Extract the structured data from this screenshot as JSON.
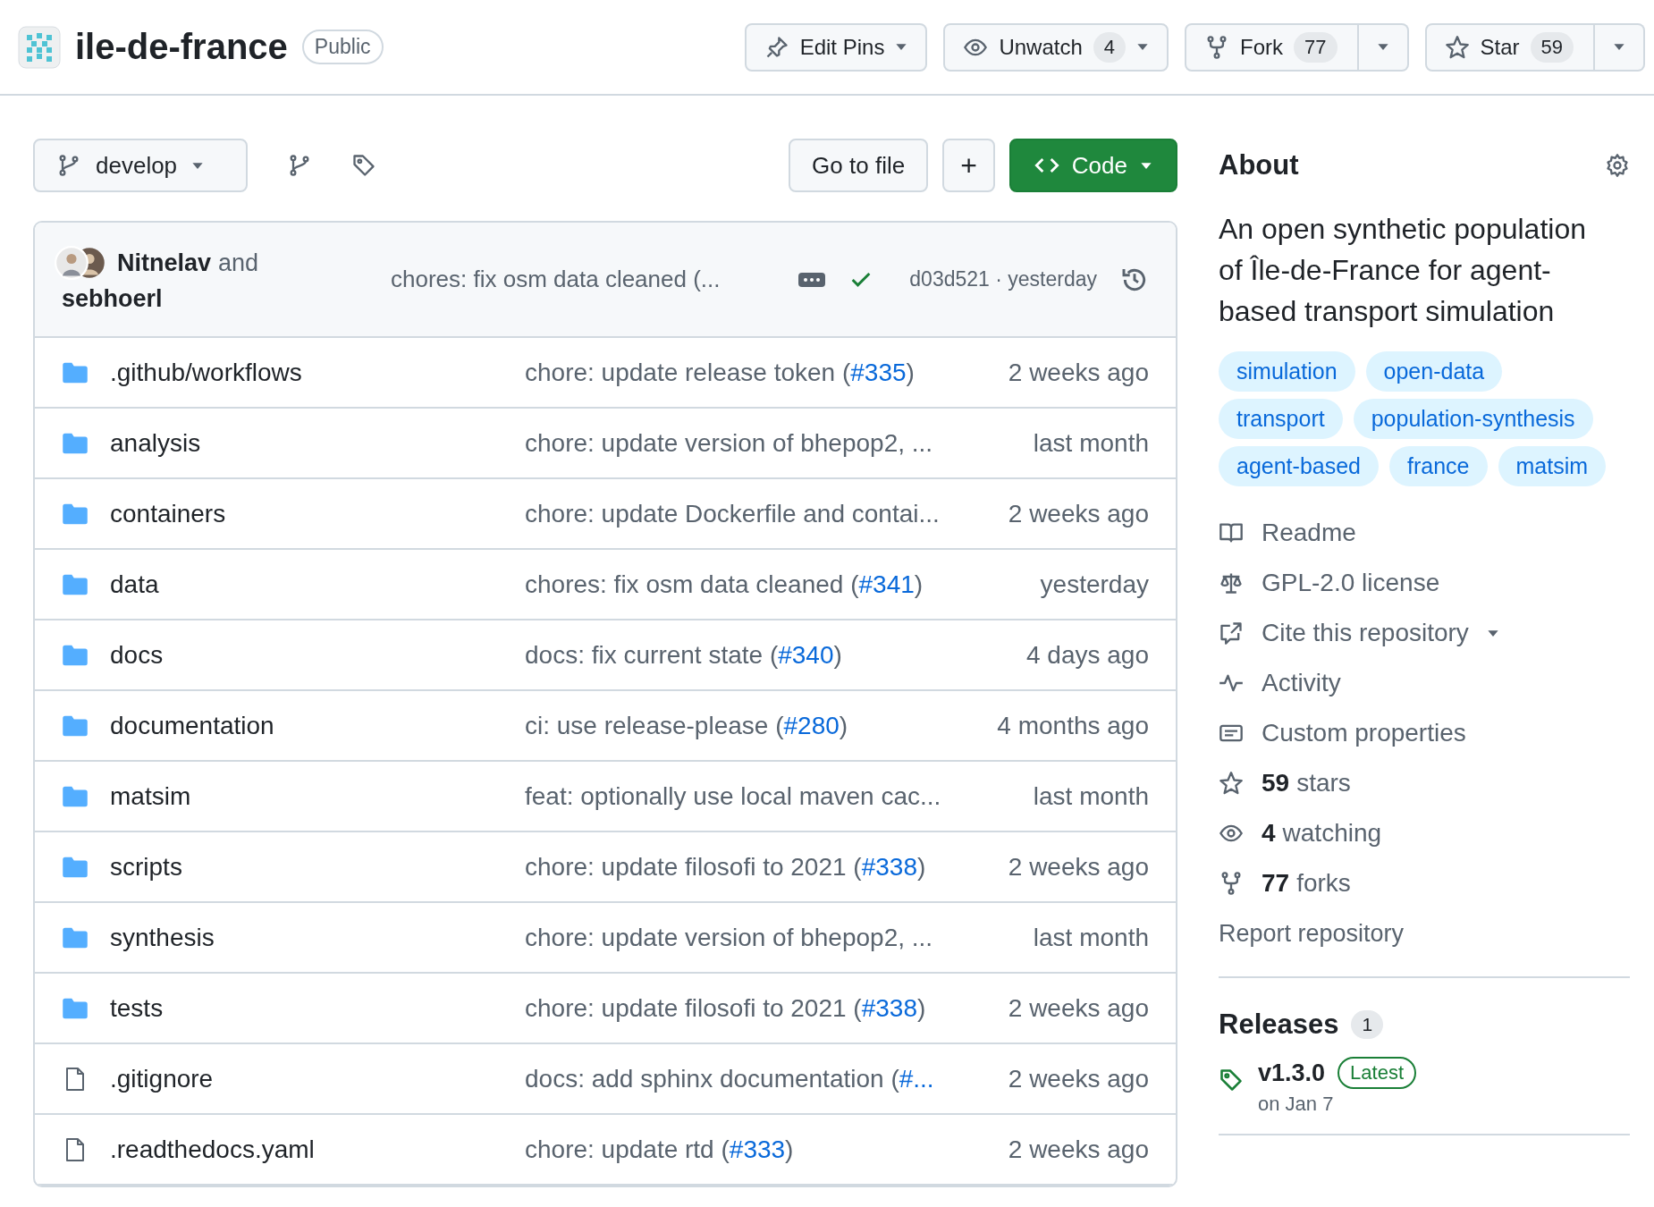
{
  "repo": {
    "name": "ile-de-france",
    "visibility": "Public"
  },
  "actions": [
    {
      "kind": "pins",
      "label": "Edit Pins"
    },
    {
      "kind": "watch",
      "label": "Unwatch",
      "count": "4"
    },
    {
      "kind": "fork",
      "label": "Fork",
      "count": "77"
    },
    {
      "kind": "star",
      "label": "Star",
      "count": "59"
    }
  ],
  "branch": {
    "name": "develop"
  },
  "toolbar": {
    "go_to_file": "Go to file",
    "add": "+",
    "code": "Code"
  },
  "latest_commit": {
    "author1": "Nitnelav",
    "joiner": "and",
    "author2": "sebhoerl",
    "message": "chores: fix osm data cleaned (...",
    "hash": "d03d521 · yesterday",
    "status_ok": true
  },
  "files": [
    {
      "kind": "dir",
      "name": ".github/workflows",
      "message": "chore: update release token (",
      "pr": "#335",
      "suffix": ")",
      "date": "2 weeks ago"
    },
    {
      "kind": "dir",
      "name": "analysis",
      "message": "chore: update version of bhepop2, ...",
      "date": "last month"
    },
    {
      "kind": "dir",
      "name": "containers",
      "message": "chore: update Dockerfile and contai...",
      "date": "2 weeks ago"
    },
    {
      "kind": "dir",
      "name": "data",
      "message": "chores: fix osm data cleaned (",
      "pr": "#341",
      "suffix": ")",
      "date": "yesterday"
    },
    {
      "kind": "dir",
      "name": "docs",
      "message": "docs: fix current state (",
      "pr": "#340",
      "suffix": ")",
      "date": "4 days ago"
    },
    {
      "kind": "dir",
      "name": "documentation",
      "message": "ci: use release-please (",
      "pr": "#280",
      "suffix": ")",
      "date": "4 months ago"
    },
    {
      "kind": "dir",
      "name": "matsim",
      "message": "feat: optionally use local maven cac...",
      "date": "last month"
    },
    {
      "kind": "dir",
      "name": "scripts",
      "message": "chore: update filosofi to 2021 (",
      "pr": "#338",
      "suffix": ")",
      "date": "2 weeks ago"
    },
    {
      "kind": "dir",
      "name": "synthesis",
      "message": "chore: update version of bhepop2, ...",
      "date": "last month"
    },
    {
      "kind": "dir",
      "name": "tests",
      "message": "chore: update filosofi to 2021 (",
      "pr": "#338",
      "suffix": ")",
      "date": "2 weeks ago"
    },
    {
      "kind": "file",
      "name": ".gitignore",
      "message": "docs: add sphinx documentation (",
      "pr": "#...",
      "date": "2 weeks ago"
    },
    {
      "kind": "file",
      "name": ".readthedocs.yaml",
      "message": "chore: update rtd (",
      "pr": "#333",
      "suffix": ")",
      "date": "2 weeks ago"
    }
  ],
  "about": {
    "title": "About",
    "description": "An open synthetic population of Île-de-France for agent-based transport simulation",
    "topics": [
      "simulation",
      "open-data",
      "transport",
      "population-synthesis",
      "agent-based",
      "france",
      "matsim"
    ],
    "links": [
      {
        "kind": "readme",
        "text": "Readme"
      },
      {
        "kind": "license",
        "text": "GPL-2.0 license"
      },
      {
        "kind": "cite",
        "text": "Cite this repository"
      },
      {
        "kind": "activity",
        "text": "Activity"
      },
      {
        "kind": "props",
        "text": "Custom properties"
      },
      {
        "kind": "stars",
        "bold": "59",
        "text": "stars"
      },
      {
        "kind": "watching",
        "bold": "4",
        "text": "watching"
      },
      {
        "kind": "forks",
        "bold": "77",
        "text": "forks"
      }
    ],
    "report": "Report repository"
  },
  "releases": {
    "title": "Releases",
    "count": "1",
    "items": [
      {
        "version": "v1.3.0",
        "badge": "Latest",
        "date": "on Jan 7"
      }
    ]
  }
}
